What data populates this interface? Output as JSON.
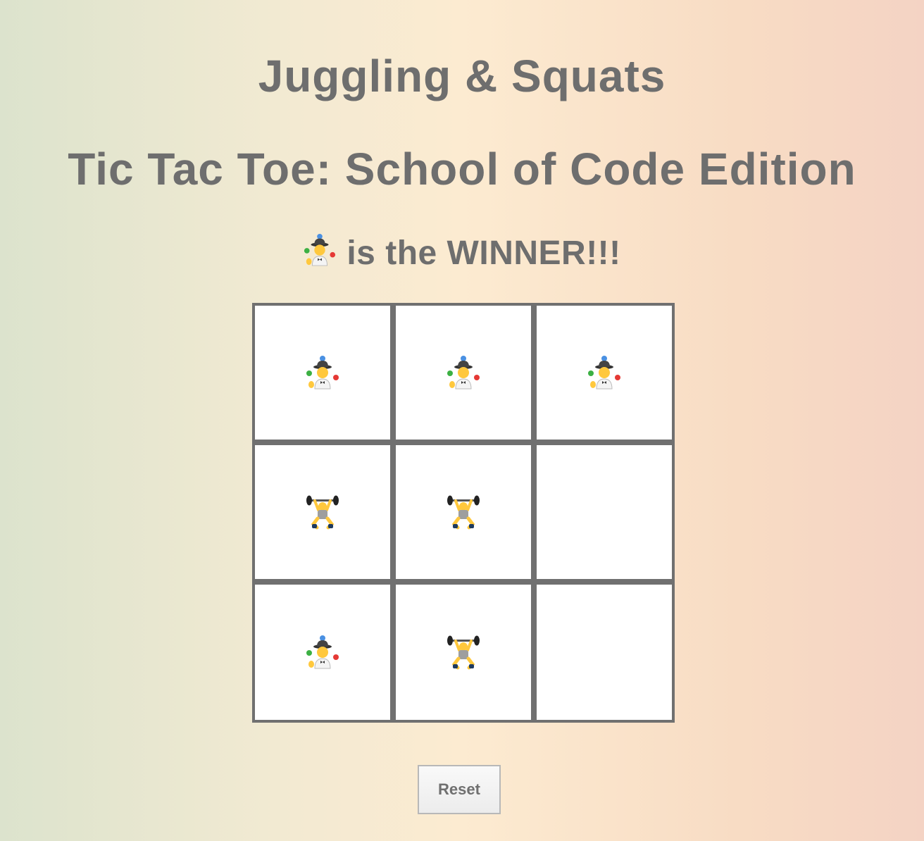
{
  "header": {
    "title": "Juggling & Squats",
    "subtitle": "Tic Tac Toe: School of Code Edition"
  },
  "status": {
    "winner_icon": "juggler-icon",
    "text": "is the WINNER!!!"
  },
  "board": {
    "cells": [
      "juggler-icon",
      "juggler-icon",
      "juggler-icon",
      "weightlifter-icon",
      "weightlifter-icon",
      "",
      "juggler-icon",
      "weightlifter-icon",
      ""
    ]
  },
  "controls": {
    "reset_label": "Reset"
  },
  "colors": {
    "text": "#6e6e6e",
    "grid_border": "#707070",
    "cell_background": "#ffffff"
  }
}
